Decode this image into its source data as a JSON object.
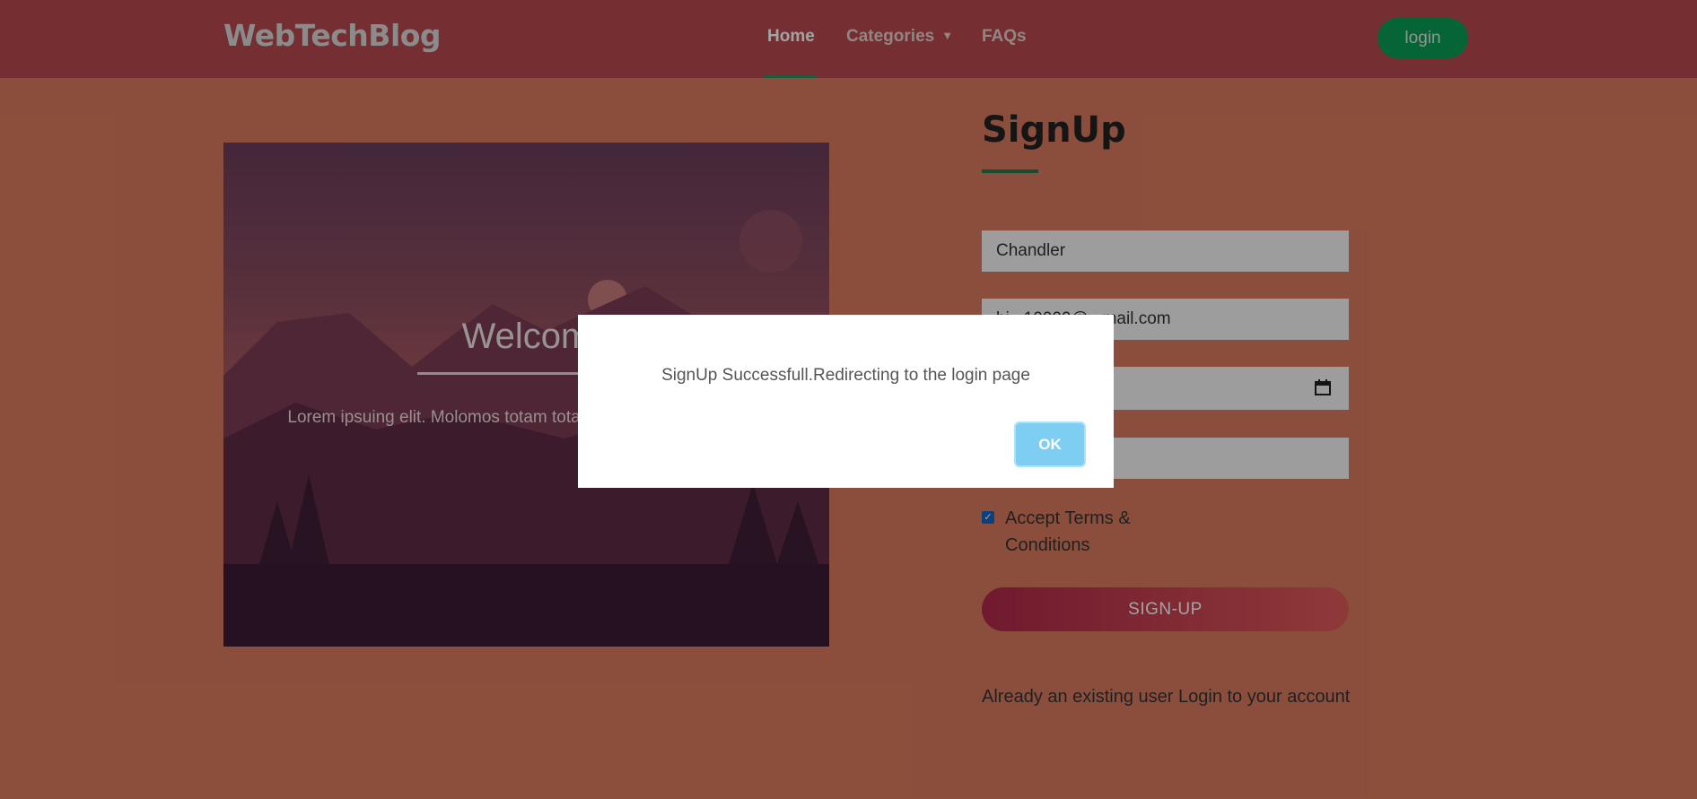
{
  "navbar": {
    "brand": "WebTechBlog",
    "items": [
      {
        "label": "Home"
      },
      {
        "label": "Categories"
      },
      {
        "label": "FAQs"
      }
    ],
    "login_label": "login"
  },
  "hero": {
    "title": "Welcom",
    "text": "Lorem ipsuing elit. Molomos totam totam est voluptatum i ure si"
  },
  "form": {
    "title": "SignUp",
    "name_value": "Chandler",
    "email_value": "bi...10000@...mail.com",
    "date_value": "",
    "password_value": "",
    "terms_label": "Accept Terms & Conditions",
    "terms_checked": true,
    "submit_label": "SIGN-UP",
    "footer_text": "Already an existing user Login to your account"
  },
  "dialog": {
    "message": "SignUp Successfull.Redirecting to the login page",
    "ok_label": "OK"
  },
  "colors": {
    "navbar": "#b7484e",
    "background": "#d97b5e",
    "accent_green": "#0a9e55",
    "ok_button": "#7ecef4"
  },
  "icons": [
    "chevron-down-icon",
    "calendar-icon",
    "checkbox-checked-icon"
  ]
}
